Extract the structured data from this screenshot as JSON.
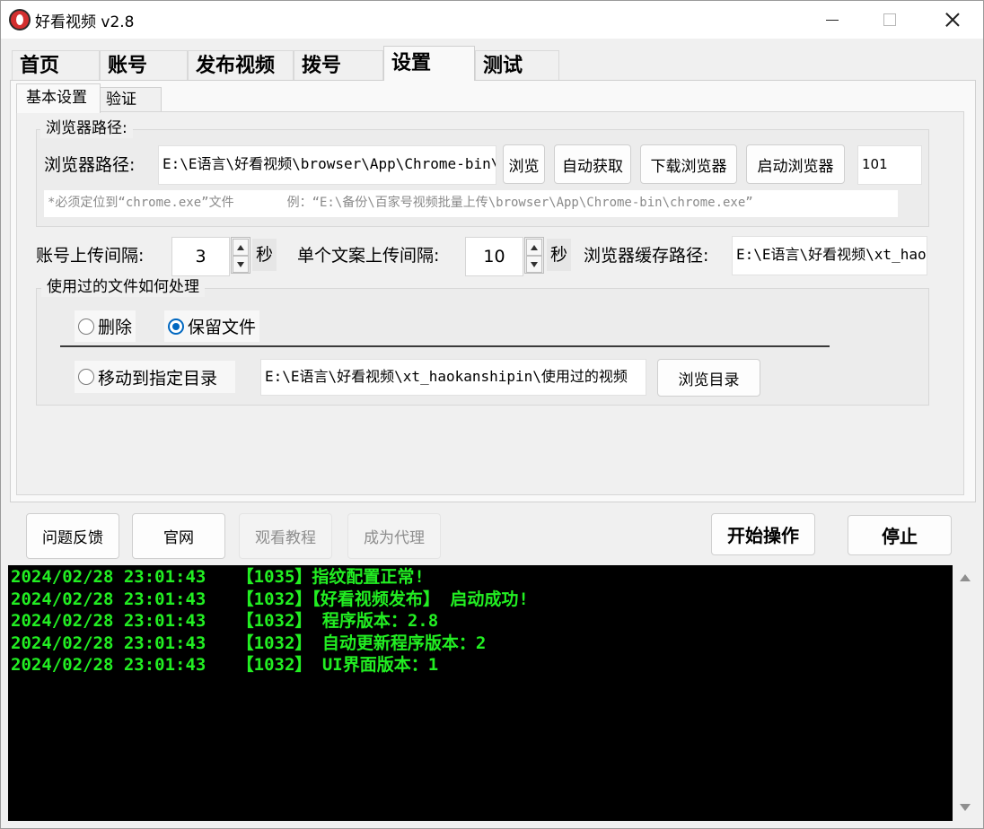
{
  "window": {
    "title": "好看视频  v2.8"
  },
  "main_tabs": [
    {
      "label": "首页"
    },
    {
      "label": "账号"
    },
    {
      "label": "发布视频"
    },
    {
      "label": "拨号"
    },
    {
      "label": "设置"
    },
    {
      "label": "测试"
    }
  ],
  "active_main_tab": "设置",
  "sub_tabs": [
    {
      "label": "基本设置"
    },
    {
      "label": "验证"
    }
  ],
  "active_sub_tab": "基本设置",
  "browser_group": {
    "title": "浏览器路径:",
    "path_label": "浏览器路径:",
    "path_value": "E:\\E语言\\好看视频\\browser\\App\\Chrome-bin\\chrome.exe",
    "browse_button": "浏览",
    "auto_get_button": "自动获取",
    "download_button": "下载浏览器",
    "launch_button": "启动浏览器",
    "version_value": "101",
    "hint": "*必须定位到“chrome.exe”文件       例：“E:\\备份\\百家号视频批量上传\\browser\\App\\Chrome-bin\\chrome.exe”"
  },
  "intervals": {
    "account_label": "账号上传间隔:",
    "account_value": "3",
    "account_unit": "秒",
    "copy_label": "单个文案上传间隔:",
    "copy_value": "10",
    "copy_unit": "秒",
    "cache_label": "浏览器缓存路径:",
    "cache_value": "E:\\E语言\\好看视频\\xt_haokanshipin\\cache"
  },
  "used_files_group": {
    "title": "使用过的文件如何处理",
    "delete_label": "删除",
    "keep_label": "保留文件",
    "move_label": "移动到指定目录",
    "selected": "保留文件",
    "move_path": "E:\\E语言\\好看视频\\xt_haokanshipin\\使用过的视频",
    "browse_dir_button": "浏览目录"
  },
  "bottom_buttons": {
    "feedback": "问题反馈",
    "website": "官网",
    "tutorial": "观看教程",
    "agent": "成为代理",
    "start": "开始操作",
    "stop": "停止"
  },
  "log_lines": [
    "2024/02/28 23:01:43   【1035】指纹配置正常!",
    "2024/02/28 23:01:43   【1032】【好看视频发布】 启动成功!",
    "2024/02/28 23:01:43   【1032】 程序版本：2.8",
    "2024/02/28 23:01:43   【1032】 自动更新程序版本：2",
    "2024/02/28 23:01:43   【1032】 UI界面版本：1"
  ]
}
